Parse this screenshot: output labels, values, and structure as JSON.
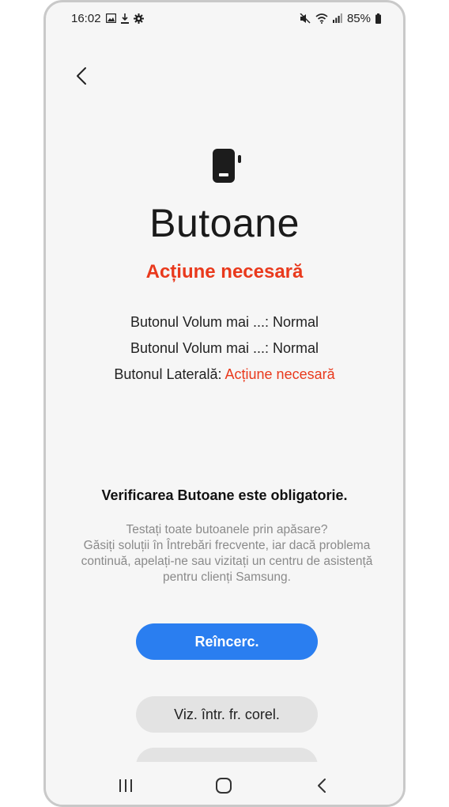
{
  "statusbar": {
    "time": "16:02",
    "battery": "85%",
    "icons_left": [
      "gallery-icon",
      "download-icon",
      "settings-icon"
    ],
    "icons_right": [
      "mute-icon",
      "wifi-icon",
      "signal-icon",
      "battery-icon"
    ]
  },
  "header": {
    "back_icon": "chevron-left-icon"
  },
  "main": {
    "icon": "phone-side-button-icon",
    "title": "Butoane",
    "status": "Acțiune necesară",
    "results": [
      {
        "label": "Butonul Volum mai ...:",
        "value": "Normal",
        "state": "ok"
      },
      {
        "label": "Butonul Volum mai ...:",
        "value": "Normal",
        "state": "ok"
      },
      {
        "label": "Butonul Laterală:",
        "value": "Acțiune necesară",
        "state": "action"
      }
    ],
    "mandatory_text": "Verificarea Butoane este obligatorie.",
    "help_lines": [
      "Testați toate butoanele prin apăsare?",
      "Găsiți soluții în Întrebări frecvente, iar dacă problema",
      "continuă, apelați-ne sau vizitați un centru de asistență",
      "pentru clienți Samsung."
    ]
  },
  "buttons": {
    "retry_label": "Reîncerc.",
    "faq_label": "Viz. într. fr. corel."
  },
  "navbar": {
    "recents_icon": "recents-icon",
    "home_icon": "home-icon",
    "back_icon": "back-icon"
  },
  "colors": {
    "accent": "#2a7ef0",
    "warning": "#e9391c",
    "background": "#f6f6f6"
  }
}
